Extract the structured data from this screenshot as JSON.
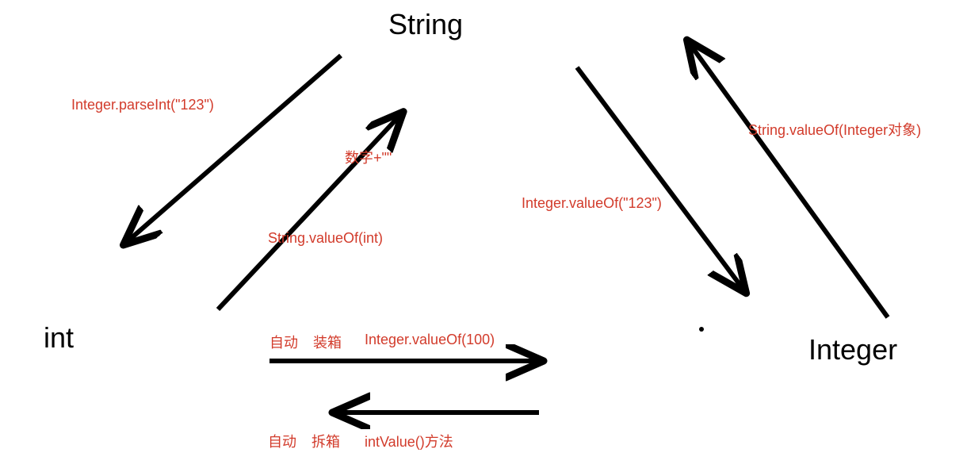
{
  "nodes": {
    "string": "String",
    "int": "int",
    "integer": "Integer"
  },
  "labels": {
    "parseInt": "Integer.parseInt(\"123\")",
    "numberPlus": "数字+\"\"",
    "stringValueOfInt": "String.valueOf(int)",
    "autoBox": "自动",
    "autoBox2": "装箱",
    "integerValueOf100": "Integer.valueOf(100)",
    "autoUnbox": "自动",
    "autoUnbox2": "拆箱",
    "intValue": "intValue()方法",
    "integerValueOfStr": "Integer.valueOf(\"123\")",
    "stringValueOfInteger": "String.valueOf(Integer对象)"
  }
}
